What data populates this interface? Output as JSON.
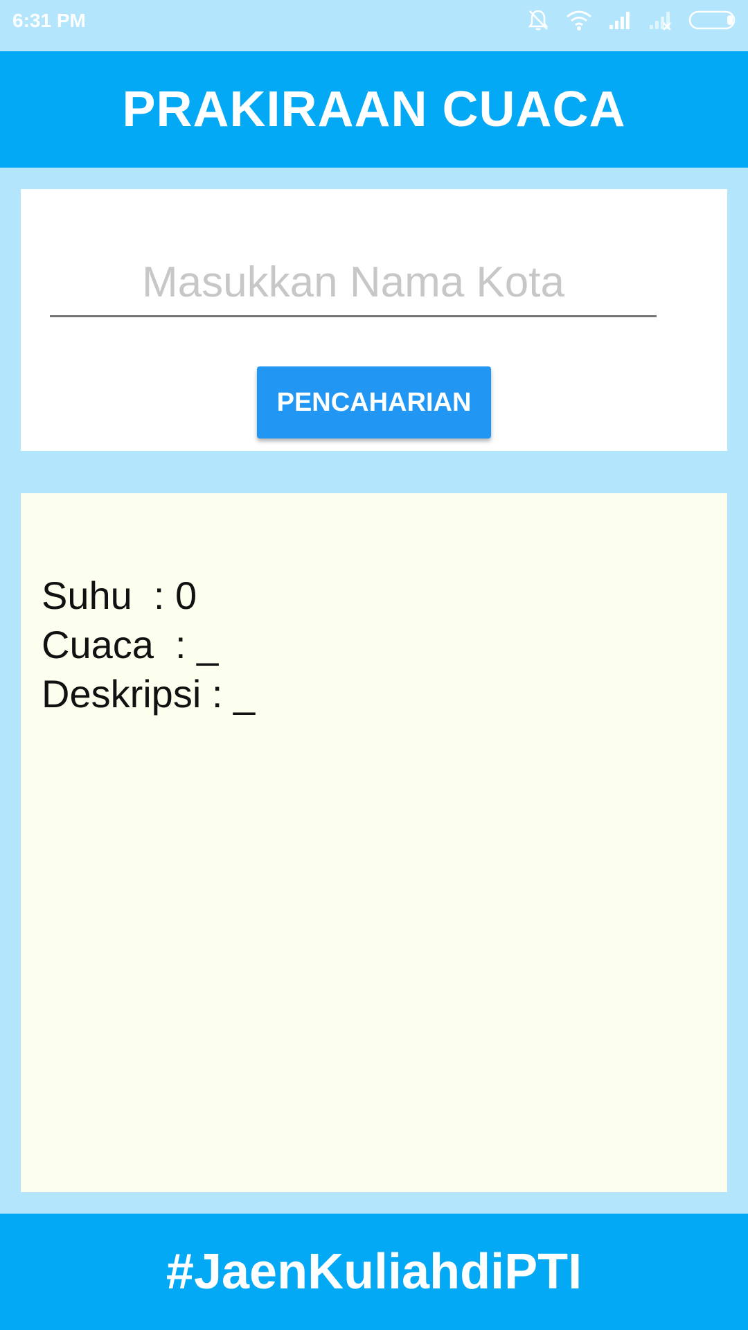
{
  "status_bar": {
    "time": "6:31 PM",
    "icons": [
      "muted-bell-icon",
      "wifi-icon",
      "signal-icon",
      "no-signal-icon",
      "battery-icon"
    ]
  },
  "header": {
    "title": "PRAKIRAAN CUACA"
  },
  "search": {
    "placeholder": "Masukkan Nama Kota",
    "value": "",
    "button_label": "PENCAHARIAN"
  },
  "result": {
    "temperature_line": "Suhu  : 0",
    "weather_line": "Cuaca  : _",
    "description_line": "Deskripsi : _"
  },
  "footer": {
    "text": "#JaenKuliahdiPTI"
  },
  "colors": {
    "background": "#b3e5fc",
    "primary": "#03a9f4",
    "button": "#2196f3",
    "result_bg": "#fdffee"
  }
}
